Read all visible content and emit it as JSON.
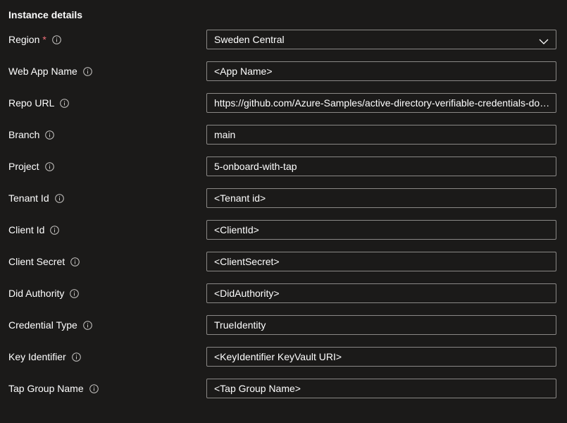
{
  "section": {
    "title": "Instance details"
  },
  "fields": [
    {
      "label": "Region",
      "required": "*",
      "value": "Sweden Central"
    },
    {
      "label": "Web App Name",
      "value": "<App Name>"
    },
    {
      "label": "Repo URL",
      "value": "https://github.com/Azure-Samples/active-directory-verifiable-credentials-dotnet"
    },
    {
      "label": "Branch",
      "value": "main"
    },
    {
      "label": "Project",
      "value": "5-onboard-with-tap"
    },
    {
      "label": "Tenant Id",
      "value": "<Tenant id>"
    },
    {
      "label": "Client Id",
      "value": "<ClientId>"
    },
    {
      "label": "Client Secret",
      "value": "<ClientSecret>"
    },
    {
      "label": "Did Authority",
      "value": "<DidAuthority>"
    },
    {
      "label": "Credential Type",
      "value": "TrueIdentity"
    },
    {
      "label": "Key Identifier",
      "value": "<KeyIdentifier KeyVault URI>"
    },
    {
      "label": "Tap Group Name",
      "value": "<Tap Group Name>"
    }
  ],
  "icons": {
    "info": "info-circle-icon",
    "dropdown": "chevron-down-icon"
  },
  "colors": {
    "background": "#1b1a19",
    "border": "#8a8886",
    "required": "#f1707b",
    "text": "#ffffff"
  }
}
